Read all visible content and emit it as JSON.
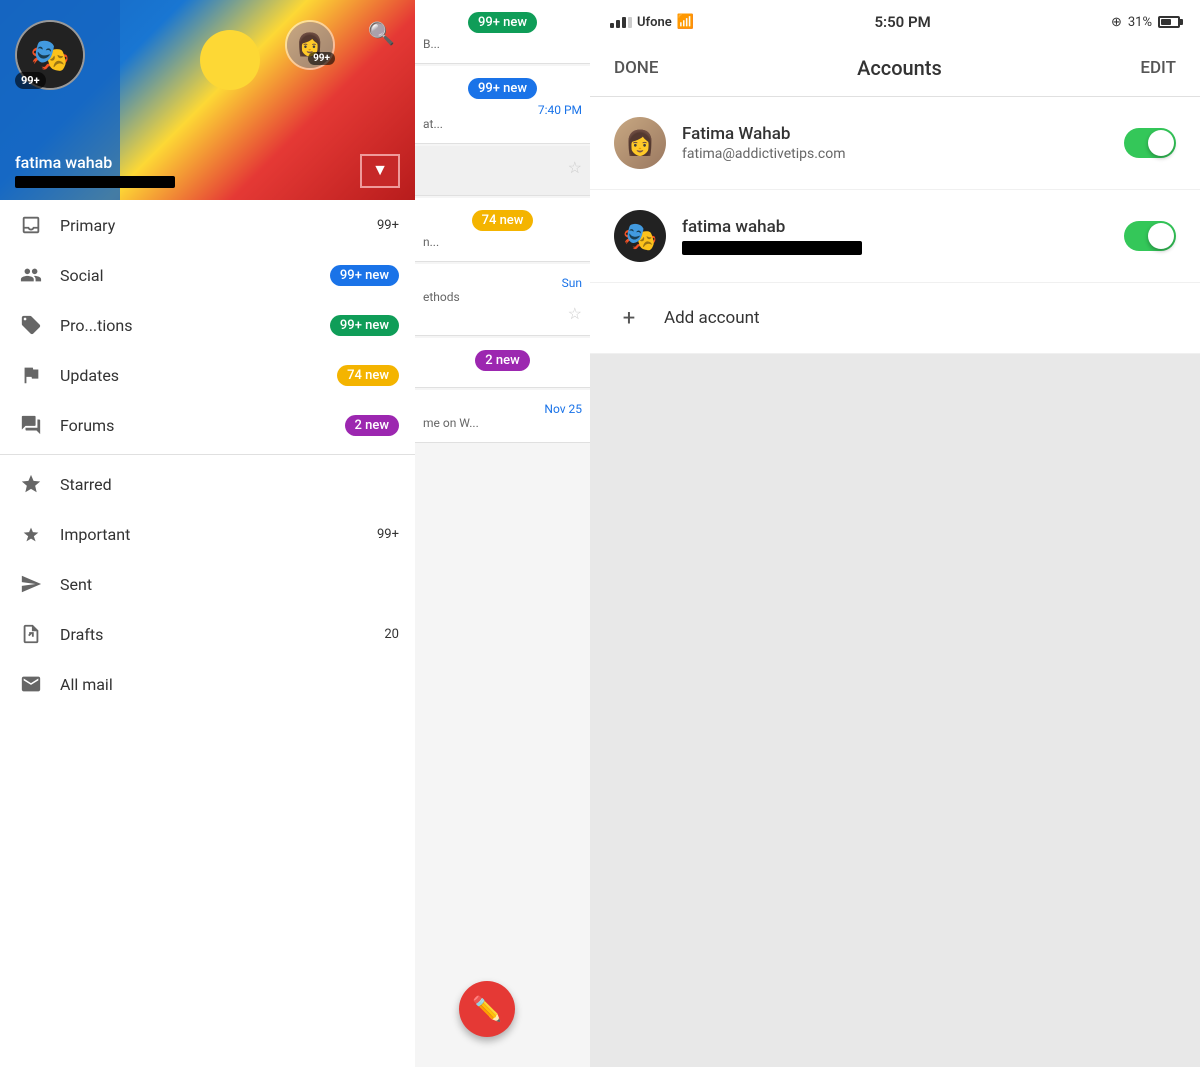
{
  "leftPanel": {
    "header": {
      "primaryUser": {
        "name": "fatima wahab",
        "badge": "99+",
        "avatar_emoji": "🎭"
      },
      "secondaryUser": {
        "badge": "99+",
        "avatar_emoji": "👩"
      },
      "searchLabel": "search"
    },
    "dropdownArrow": "▼",
    "navItems": [
      {
        "id": "primary",
        "label": "Primary",
        "badge": "99+",
        "badgeType": "text",
        "icon": "inbox"
      },
      {
        "id": "social",
        "label": "Social",
        "badge": "99+ new",
        "badgeType": "blue",
        "icon": "people"
      },
      {
        "id": "promotions",
        "label": "Pro...tions",
        "badge": "99+ new",
        "badgeType": "green",
        "icon": "tag"
      },
      {
        "id": "updates",
        "label": "Updates",
        "badge": "74 new",
        "badgeType": "yellow",
        "icon": "flag"
      },
      {
        "id": "forums",
        "label": "Forums",
        "badge": "2 new",
        "badgeType": "purple",
        "icon": "forum"
      },
      {
        "id": "starred",
        "label": "Starred",
        "badge": "",
        "badgeType": "none",
        "icon": "star"
      },
      {
        "id": "important",
        "label": "Important",
        "badge": "99+",
        "badgeType": "text",
        "icon": "important"
      },
      {
        "id": "sent",
        "label": "Sent",
        "badge": "",
        "badgeType": "none",
        "icon": "sent"
      },
      {
        "id": "drafts",
        "label": "Drafts",
        "badge": "20",
        "badgeType": "text",
        "icon": "draft"
      },
      {
        "id": "allmail",
        "label": "All mail",
        "badge": "",
        "badgeType": "none",
        "icon": "mail"
      }
    ],
    "emailList": [
      {
        "badge": "99+ new",
        "badgeType": "green",
        "time": "",
        "snippet": "B..."
      },
      {
        "badge": "99+ new",
        "badgeType": "blue",
        "time": "7:40 PM",
        "snippet": "at..."
      },
      {
        "badge": "",
        "time": "",
        "snippet": ""
      },
      {
        "badge": "74 new",
        "badgeType": "yellow",
        "time": "",
        "snippet": "n..."
      },
      {
        "badge": "",
        "time": "Sun",
        "snippet": "ethods"
      },
      {
        "badge": "2 new",
        "badgeType": "purple",
        "time": "",
        "snippet": ""
      },
      {
        "badge": "",
        "time": "Nov 25",
        "snippet": "me on W..."
      }
    ],
    "composeFab": "✏️"
  },
  "rightPanel": {
    "statusBar": {
      "carrier": "Ufone",
      "wifi": "wifi",
      "time": "5:50 PM",
      "battery": "31%"
    },
    "header": {
      "done": "DONE",
      "title": "Accounts",
      "edit": "EDIT"
    },
    "accounts": [
      {
        "id": "account1",
        "name": "Fatima Wahab",
        "email": "fatima@addictivetips.com",
        "toggleOn": true,
        "avatarType": "photo"
      },
      {
        "id": "account2",
        "name": "fatima wahab",
        "email": "",
        "redacted": true,
        "toggleOn": true,
        "avatarType": "anime"
      }
    ],
    "addAccount": {
      "icon": "+",
      "label": "Add account"
    }
  }
}
